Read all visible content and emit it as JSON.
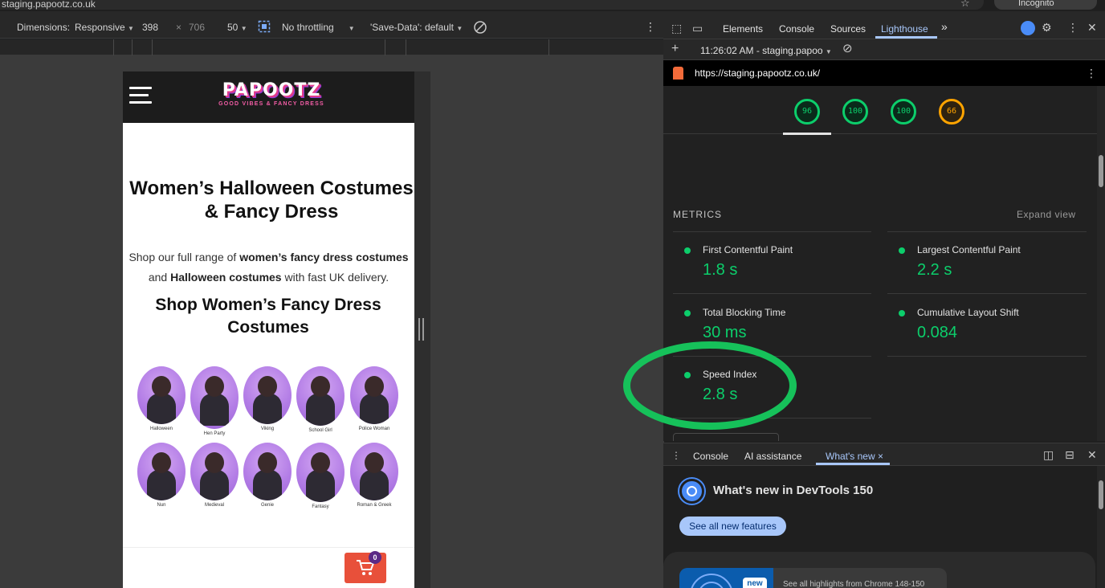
{
  "browser": {
    "url_text": "staging.papootz.co.uk",
    "incognito_label": "Incognito"
  },
  "device_toolbar": {
    "dimensions_label": "Dimensions:",
    "dimensions_value": "Responsive",
    "width": "398",
    "times": "×",
    "height": "706",
    "zoom": "50",
    "throttling": "No throttling",
    "save_data": "'Save-Data': default"
  },
  "site": {
    "logo_main": "PAPOOTZ",
    "logo_sub": "GOOD VIBES & FANCY DRESS",
    "h1": "Women’s Halloween Costumes & Fancy Dress",
    "p_1": "Shop our full range of ",
    "p_b1": "women’s fancy dress costumes",
    "p_2": " and ",
    "p_b2": "Halloween costumes",
    "p_3": " with fast UK delivery.",
    "h2": "Shop Women’s Fancy Dress Costumes",
    "categories": [
      "Halloween",
      "Hen Party",
      "Viking",
      "School Girl",
      "Police Woman",
      "Nun",
      "Medieval",
      "Genie",
      "Fantasy",
      "Roman & Greek"
    ],
    "cart_count": "0"
  },
  "devtools": {
    "tabs": [
      "Elements",
      "Console",
      "Sources",
      "Lighthouse"
    ],
    "more_tabs": "»",
    "report_time": "11:26:02 AM - staging.papoo",
    "report_url": "https://staging.papootz.co.uk/",
    "gauges": [
      "96",
      "100",
      "100",
      "66"
    ],
    "metrics_heading": "METRICS",
    "expand_view": "Expand view",
    "metrics": [
      {
        "title": "First Contentful Paint",
        "value": "1.8 s"
      },
      {
        "title": "Largest Contentful Paint",
        "value": "2.2 s"
      },
      {
        "title": "Total Blocking Time",
        "value": "30 ms"
      },
      {
        "title": "Cumulative Layout Shift",
        "value": "0.084"
      },
      {
        "title": "Speed Index",
        "value": "2.8 s"
      }
    ],
    "colors": {
      "good": "#0cce6b",
      "average": "#ffa400",
      "accent": "#a8c7fa",
      "highlight_ring": "#16c15a"
    }
  },
  "drawer": {
    "tabs": [
      "Console",
      "AI assistance",
      "What's new"
    ],
    "close_glyph": "×",
    "whats_new_title": "What's new in DevTools 150",
    "see_all": "See all new features",
    "new_badge": "new",
    "highlights_text": "See all highlights from Chrome 148-150"
  }
}
